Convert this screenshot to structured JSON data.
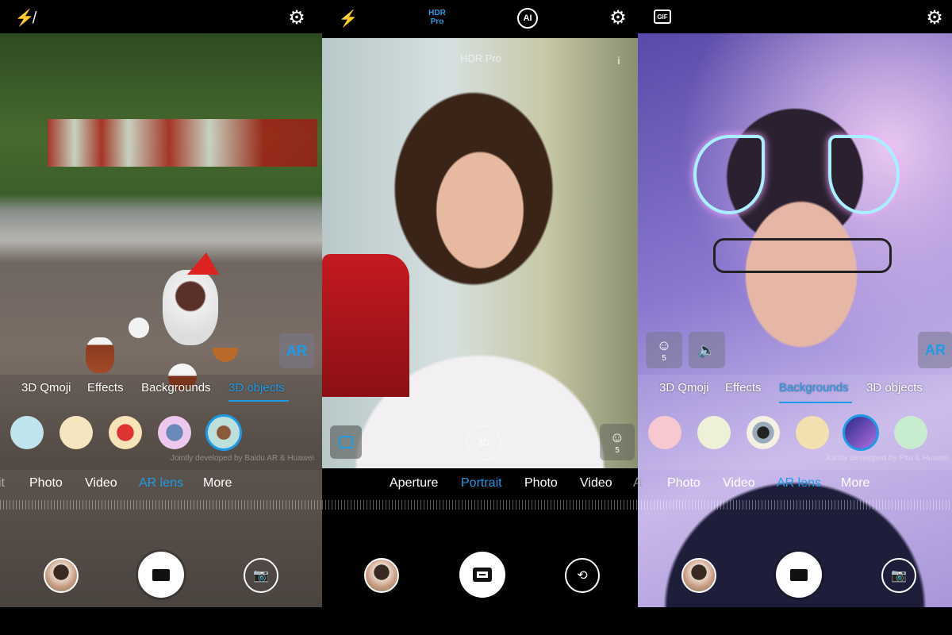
{
  "panels": [
    {
      "top_icons": [
        "flash-off-icon",
        "gear-icon"
      ],
      "ar_badge": "AR",
      "sub_tabs": [
        "3D Qmoji",
        "Effects",
        "Backgrounds",
        "3D objects"
      ],
      "sub_active": "3D objects",
      "stickers": [
        "crown-sticker",
        "fish-sticker",
        "umbrella-sticker",
        "cloud-sticker",
        "bowl-sticker"
      ],
      "watermark": "Jointly developed by Baidu AR & Huawei",
      "modes": [
        "it",
        "Photo",
        "Video",
        "AR lens",
        "More"
      ],
      "mode_active": "AR lens",
      "shutter": "video-camera-icon"
    },
    {
      "top_icons": [
        "flash-auto-icon",
        "ai-icon",
        "gear-icon"
      ],
      "hdr_label": "HDR\nPro",
      "hdr_line1": "HDR",
      "hdr_line2": "Pro",
      "hdr_banner": "HDR Pro",
      "info": "i",
      "lighting_badge": "3D",
      "beauty_level": "5",
      "modes": [
        "Aperture",
        "Portrait",
        "Photo",
        "Video",
        "A"
      ],
      "mode_active": "Portrait",
      "shutter": "camera-icon"
    },
    {
      "top_icons": [
        "gif-icon",
        "gear-icon"
      ],
      "gif_label": "GIF",
      "beauty_level": "5",
      "ar_badge": "AR",
      "sub_tabs": [
        "3D Qmoji",
        "Effects",
        "Backgrounds",
        "3D objects"
      ],
      "sub_active": "Backgrounds",
      "stickers": [
        "love-sticker",
        "bunny-sticker",
        "camera-sticker",
        "giraffe-sticker",
        "galaxy-sticker",
        "cupcake-sticker"
      ],
      "watermark": "Jointly developed by Pitu & Huawei",
      "modes": [
        "it",
        "Photo",
        "Video",
        "AR lens",
        "More"
      ],
      "mode_active": "AR lens",
      "shutter": "video-camera-icon"
    }
  ],
  "colors": {
    "accent": "#1e9be6"
  }
}
